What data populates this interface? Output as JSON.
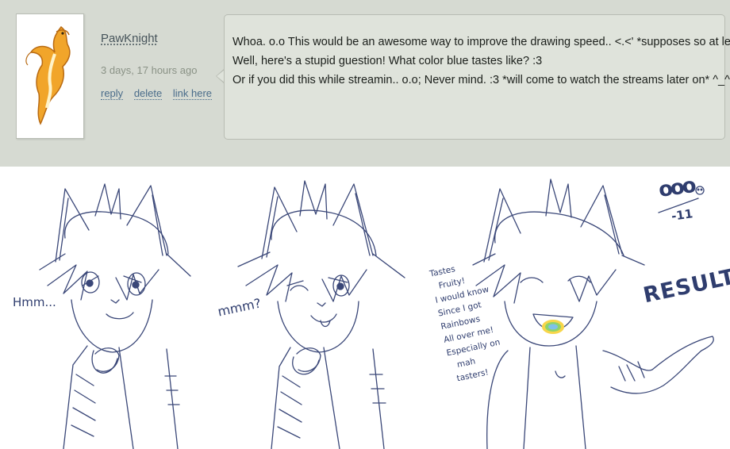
{
  "comment": {
    "username": "PawKnight",
    "timestamp": "3 days, 17 hours ago",
    "actions": {
      "reply": "reply",
      "delete": "delete",
      "link": "link here"
    },
    "lines": [
      "Whoa. o.o  This would be an awesome way to improve the drawing speed.. <.<'  *supposes so at least*",
      "Well, here's a stupid guestion! What color blue tastes like? :3",
      "Or if you did this while streamin.. o.o; Never mind. :3  *will come to watch the streams later on* ^_^"
    ]
  },
  "comic": {
    "panel1_text": "Hmm...",
    "panel2_text": "mmm?",
    "panel3_note_lines": [
      "Tastes",
      "Fruity!",
      "I would know",
      "Since I got",
      "Rainbows",
      "All over me!",
      "Especially on",
      "mah",
      "tasters!"
    ],
    "result_text": "RESULT!",
    "signature_top": "ooo",
    "signature_bottom": "-11"
  },
  "colors": {
    "panel_bg": "#d6dad2",
    "bubble_bg": "#dfe3db",
    "link": "#4a6c8a",
    "sketch": "#2f3d6e"
  }
}
